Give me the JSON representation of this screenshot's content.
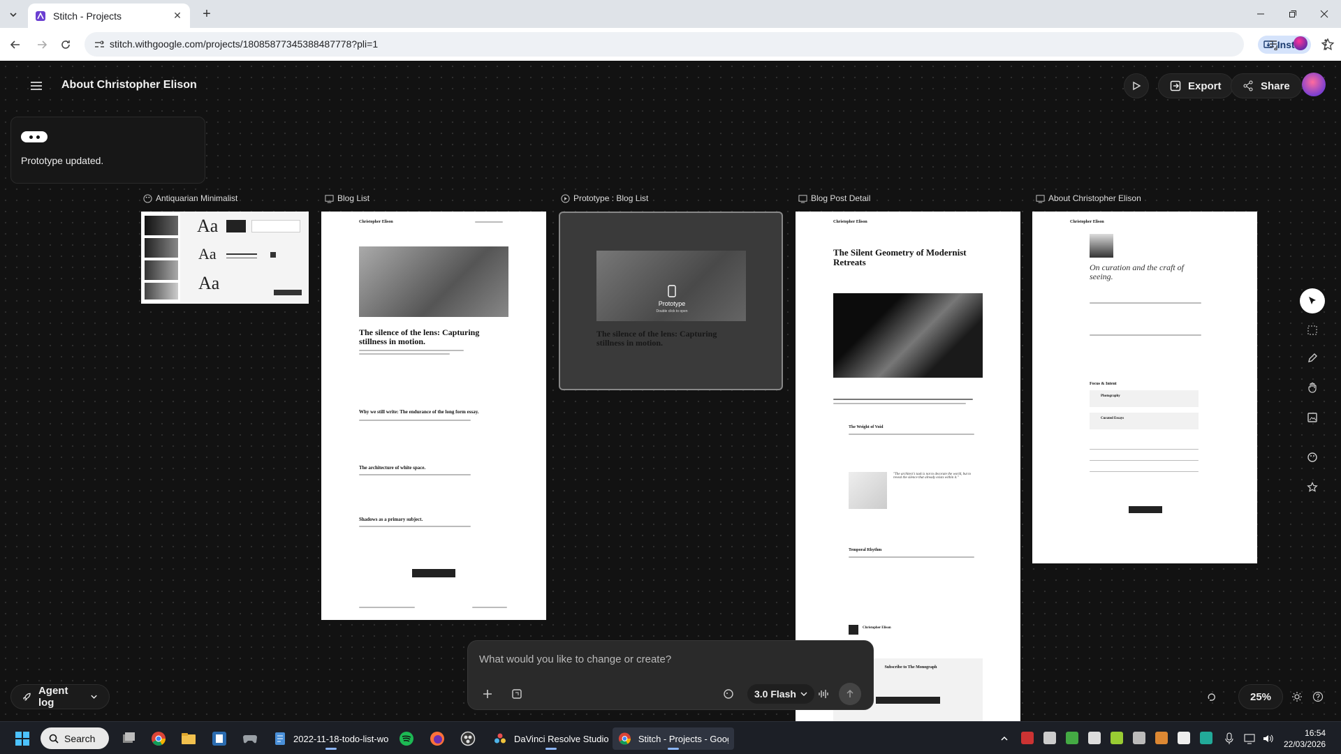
{
  "browser": {
    "tab_title": "Stitch - Projects",
    "url": "stitch.withgoogle.com/projects/18085877345388487778?pli=1",
    "install_label": "Install"
  },
  "app": {
    "project_title": "About Christopher Elison",
    "export_label": "Export",
    "share_label": "Share",
    "toast_message": "Prototype updated.",
    "agent_log_label": "Agent log",
    "prompt_placeholder": "What would you like to change or create?",
    "model_label": "3.0 Flash",
    "zoom": "25%"
  },
  "frames": [
    {
      "label": "Antiquarian Minimalist",
      "icon": "palette-icon"
    },
    {
      "label": "Blog List",
      "icon": "frame-icon"
    },
    {
      "label": "Prototype : Blog List",
      "icon": "play-circle-icon"
    },
    {
      "label": "Blog Post Detail",
      "icon": "frame-icon"
    },
    {
      "label": "About Christopher Elison",
      "icon": "frame-icon"
    }
  ],
  "design_system": {
    "type_sample": "Aa"
  },
  "blog_list": {
    "site_name": "Christopher Elison",
    "posts": [
      "The silence of the lens: Capturing stillness in motion.",
      "Why we still write: The endurance of the long form essay.",
      "The architecture of white space.",
      "Shadows as a primary subject."
    ]
  },
  "prototype": {
    "overlay_title": "Prototype",
    "overlay_sub": "Double click to open",
    "post_title": "The silence of the lens: Capturing stillness in motion."
  },
  "blog_post": {
    "site_name": "Christopher Elison",
    "title": "The Silent Geometry of Modernist Retreats",
    "section1": "The Weight of Void",
    "quote": "\"The architect's task is not to decorate the world, but to reveal the silence that already exists within it.\"",
    "section2": "Temporal Rhythm",
    "author": "Christopher Elison",
    "newsletter": "Subscribe to The Monograph"
  },
  "about": {
    "site_name": "Christopher Elison",
    "heading": "On curation and the craft of seeing.",
    "focus_heading": "Focus & Intent",
    "focus_items": [
      "Photography",
      "Curated Essays"
    ]
  },
  "taskbar": {
    "search_label": "Search",
    "apps": [
      "2022-11-18-todo-list-wo",
      "DaVinci Resolve Studio",
      "Stitch - Projects - Googl"
    ],
    "time": "16:54",
    "date": "22/03/2026"
  },
  "colors": {
    "canvas": "#121212",
    "accent_browser": "#d5e3fb",
    "taskbar": "#1c1f26"
  }
}
